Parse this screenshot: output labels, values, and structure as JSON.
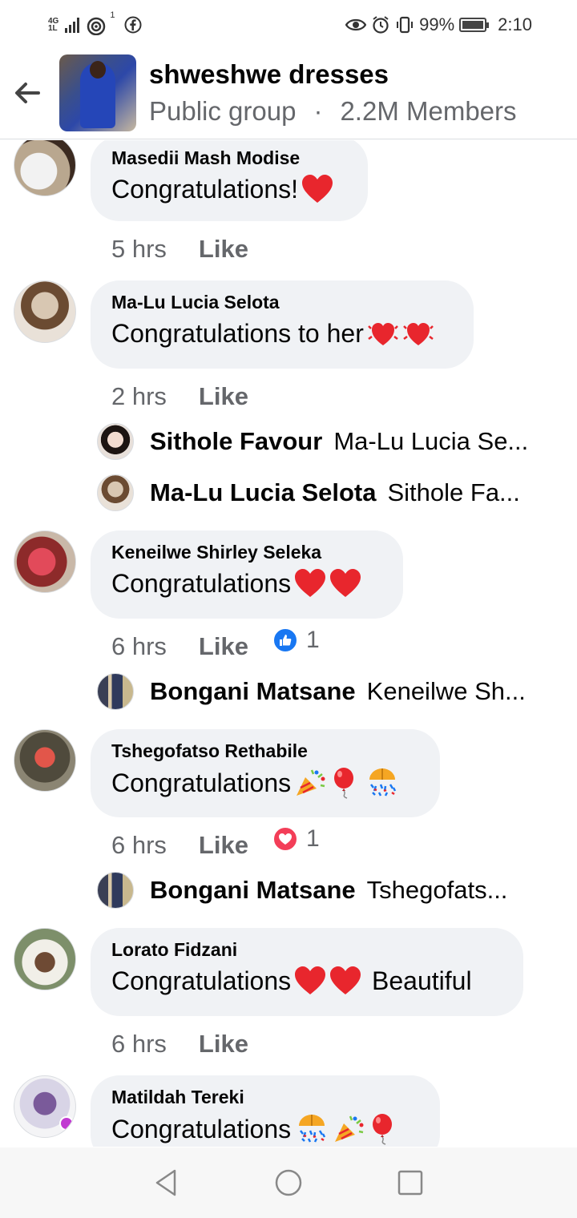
{
  "status_bar": {
    "network_type": "4G",
    "network_sub": "1L",
    "notification_count": "1",
    "battery": "99%",
    "time": "2:10"
  },
  "header": {
    "group_name": "shweshwe dresses",
    "privacy": "Public group",
    "separator": "·",
    "members": "2.2M Members"
  },
  "comments": [
    {
      "name": "Masedii Mash Modise",
      "text": "Congratulations!",
      "emojis": [
        "heart"
      ],
      "time": "5 hrs",
      "like": "Like"
    },
    {
      "name": "Ma-Lu Lucia Selota",
      "text": "Congratulations to her",
      "emojis": [
        "beating-heart",
        "beating-heart"
      ],
      "time": "2 hrs",
      "like": "Like",
      "replies": [
        {
          "name": "Sithole Favour",
          "text": "Ma-Lu Lucia Se..."
        },
        {
          "name": "Ma-Lu Lucia Selota",
          "text": "Sithole Fa..."
        }
      ]
    },
    {
      "name": "Keneilwe Shirley Seleka",
      "text": "Congratulations ",
      "emojis": [
        "heart",
        "heart"
      ],
      "time": "6 hrs",
      "like": "Like",
      "reaction": {
        "type": "like",
        "count": "1",
        "color": "#1877f2"
      },
      "replies": [
        {
          "name": "Bongani Matsane",
          "text": "Keneilwe Sh..."
        }
      ]
    },
    {
      "name": "Tshegofatso Rethabile",
      "text": "Congratulations ",
      "emojis": [
        "party-popper",
        "balloon",
        "confetti-ball"
      ],
      "time": "6 hrs",
      "like": "Like",
      "reaction": {
        "type": "love",
        "count": "1",
        "color": "#f33e58"
      },
      "replies": [
        {
          "name": "Bongani Matsane",
          "text": "Tshegofats..."
        }
      ]
    },
    {
      "name": "Lorato Fidzani",
      "text": "Congratulations ",
      "emojis": [
        "heart",
        "heart"
      ],
      "text_after": " Beautiful",
      "time": "6 hrs",
      "like": "Like"
    },
    {
      "name": "Matildah Tereki",
      "text": "Congratulations ",
      "emojis": [
        "confetti-ball",
        "party-popper",
        "balloon"
      ]
    }
  ],
  "navbar": {
    "back": "back-icon",
    "home": "home-icon",
    "recents": "recents-icon"
  },
  "colors": {
    "bubble": "#f0f2f5",
    "secondary_text": "#65676b",
    "heart": "#e8262d"
  }
}
